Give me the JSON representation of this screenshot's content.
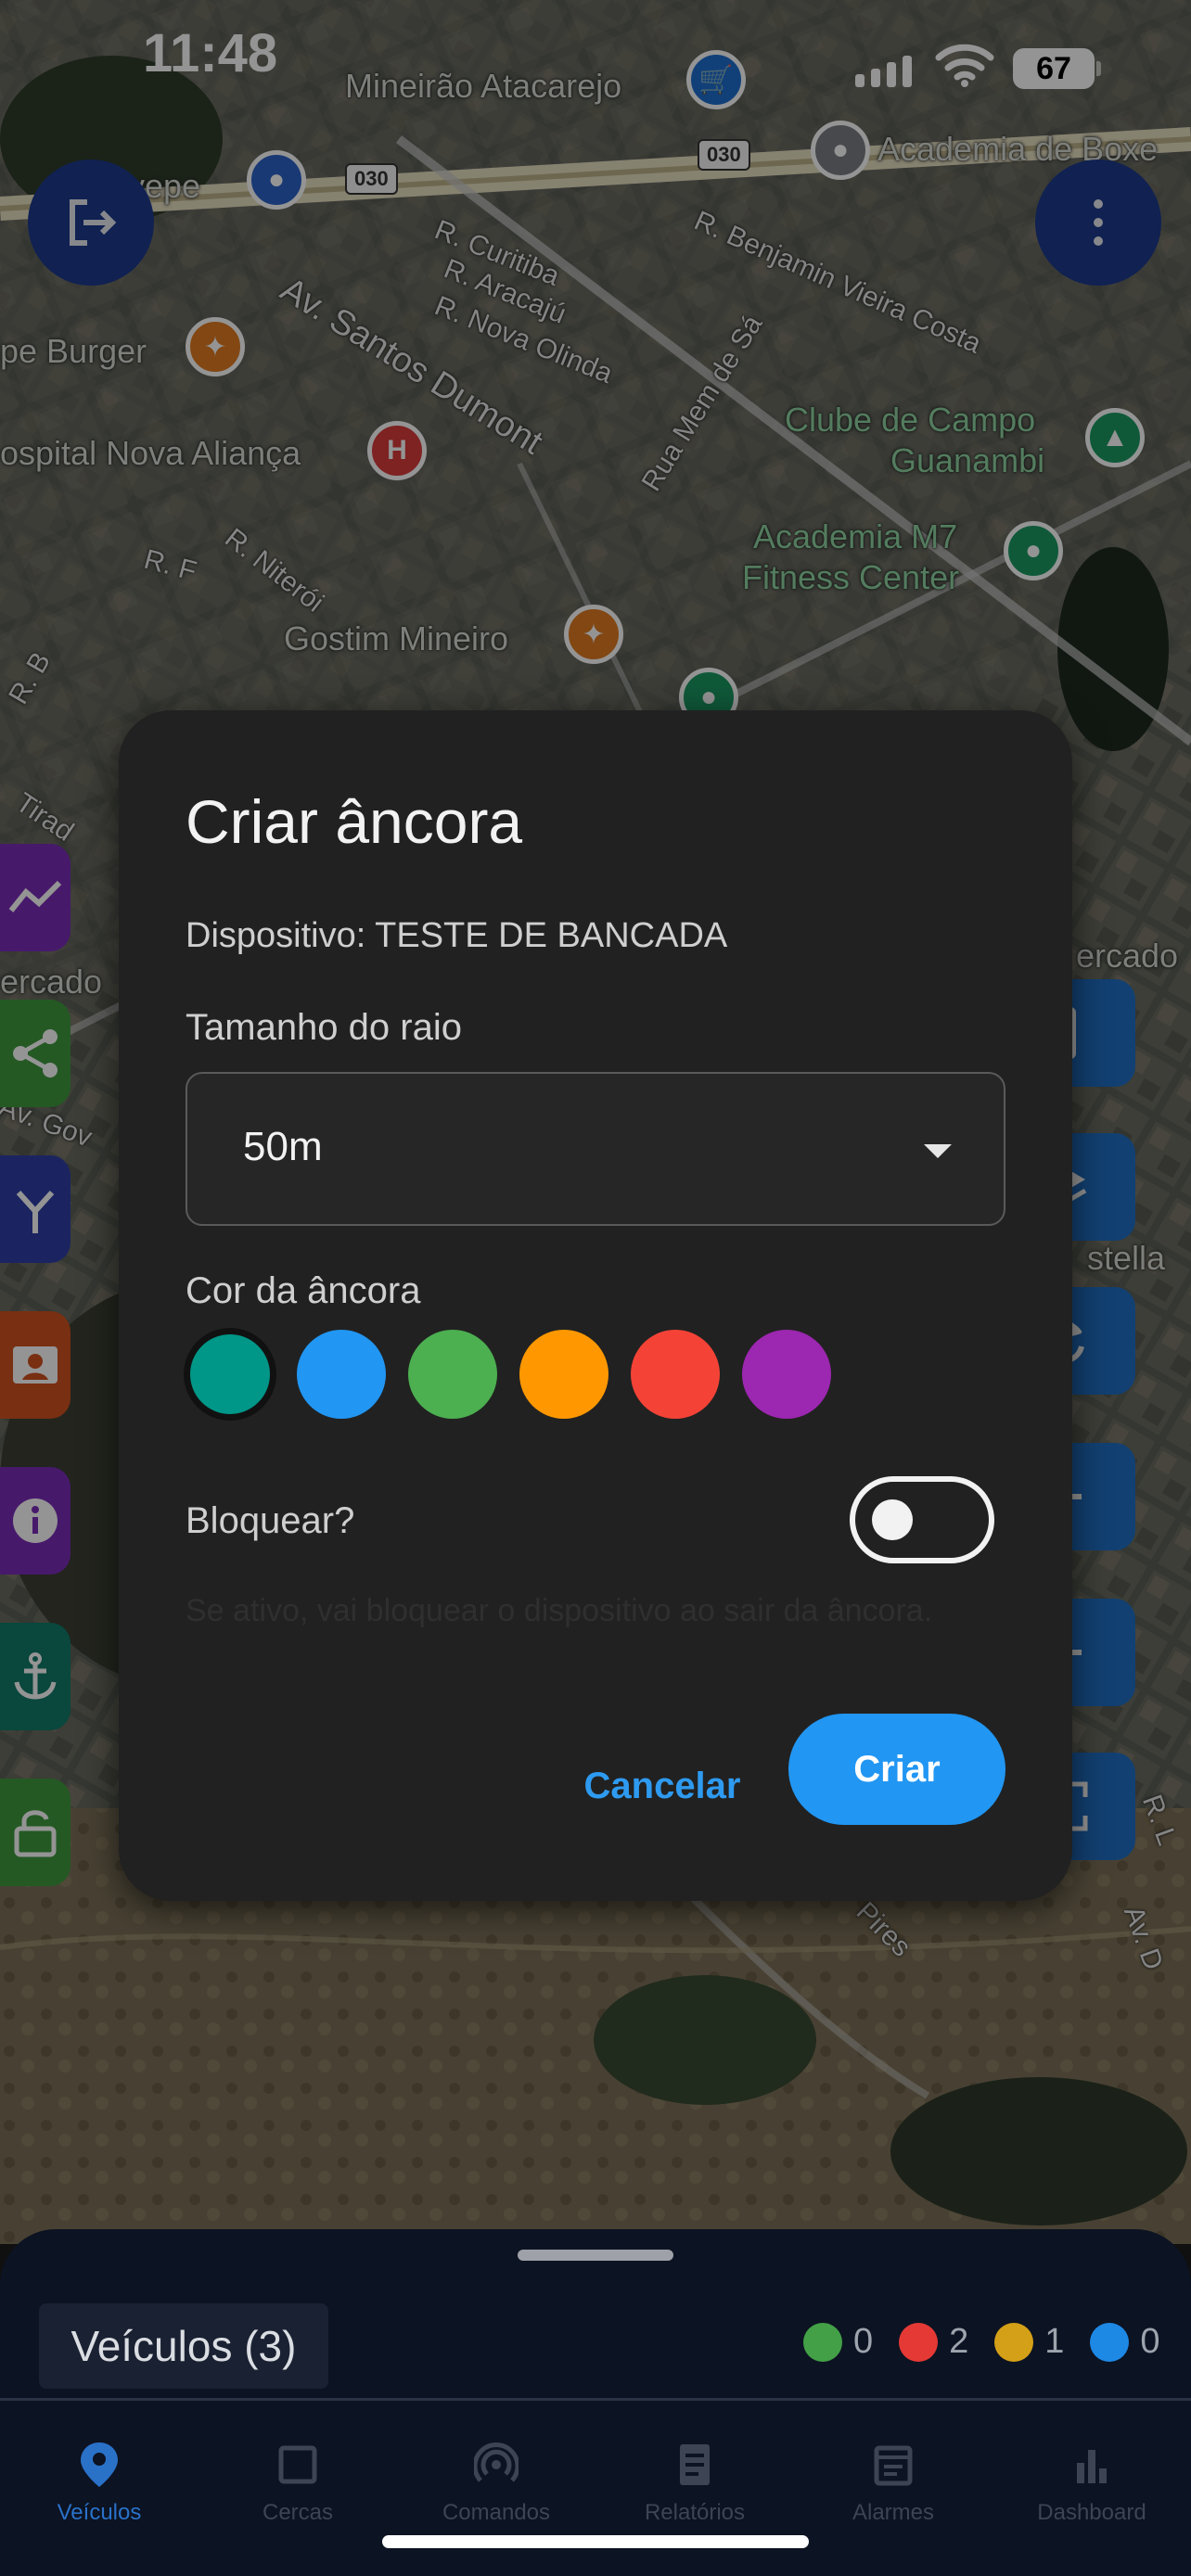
{
  "status_bar": {
    "time": "11:48",
    "battery": "67"
  },
  "map": {
    "places": [
      {
        "name": "Mineirão Atacarejo",
        "kind": "store"
      },
      {
        "name": "Academia de Boxe",
        "kind": "place"
      },
      {
        "name": "pe Burger",
        "kind": "restaurant"
      },
      {
        "name": "ospital Nova Aliança",
        "kind": "hospital"
      },
      {
        "name": "Clube de Campo",
        "kind": "park"
      },
      {
        "name": "Guanambi",
        "kind": "park"
      },
      {
        "name": "Academia M7",
        "kind": "gym"
      },
      {
        "name": "Fitness Center",
        "kind": "gym"
      },
      {
        "name": "Gostim Mineiro",
        "kind": "restaurant"
      },
      {
        "name": "vepe",
        "kind": "place"
      },
      {
        "name": "ercado",
        "kind": "place"
      },
      {
        "name": "ercado",
        "kind": "place"
      },
      {
        "name": "stella",
        "kind": "place"
      }
    ],
    "streets": [
      "R. Curitiba",
      "R. Aracajú",
      "R. Nova Olinda",
      "Av. Santos Dumont",
      "R. Benjamin Vieira Costa",
      "Rua Mem de Sá",
      "R. Niterói",
      "R. F",
      "R. B",
      "Tirad",
      "Av. Gov",
      "R. L",
      "Av. D",
      "Pires"
    ],
    "road_shields": [
      "030",
      "030"
    ]
  },
  "dialog": {
    "title": "Criar âncora",
    "device_line": "Dispositivo: TESTE DE BANCADA",
    "radius_label": "Tamanho do raio",
    "radius_value": "50m",
    "color_label": "Cor da âncora",
    "colors": [
      "#009688",
      "#2196f3",
      "#4caf50",
      "#ff9800",
      "#f44336",
      "#9c27b0"
    ],
    "selected_color": "#009688",
    "block_label": "Bloquear?",
    "block_enabled": false,
    "hint": "Se ativo, vai bloquear o dispositivo ao sair da âncora.",
    "cancel_label": "Cancelar",
    "create_label": "Criar"
  },
  "sheet": {
    "vehicles_label": "Veículos (3)",
    "counters": [
      {
        "color": "#43a047",
        "count": "0"
      },
      {
        "color": "#e53935",
        "count": "2"
      },
      {
        "color": "#d4a017",
        "count": "1"
      },
      {
        "color": "#1e88e5",
        "count": "0"
      }
    ]
  },
  "nav": [
    {
      "label": "Veículos",
      "icon": "location-pin-icon",
      "active": true
    },
    {
      "label": "Cercas",
      "icon": "square-icon",
      "active": false
    },
    {
      "label": "Comandos",
      "icon": "broadcast-icon",
      "active": false
    },
    {
      "label": "Relatórios",
      "icon": "report-icon",
      "active": false
    },
    {
      "label": "Alarmes",
      "icon": "calendar-icon",
      "active": false
    },
    {
      "label": "Dashboard",
      "icon": "bar-chart-icon",
      "active": false
    }
  ]
}
